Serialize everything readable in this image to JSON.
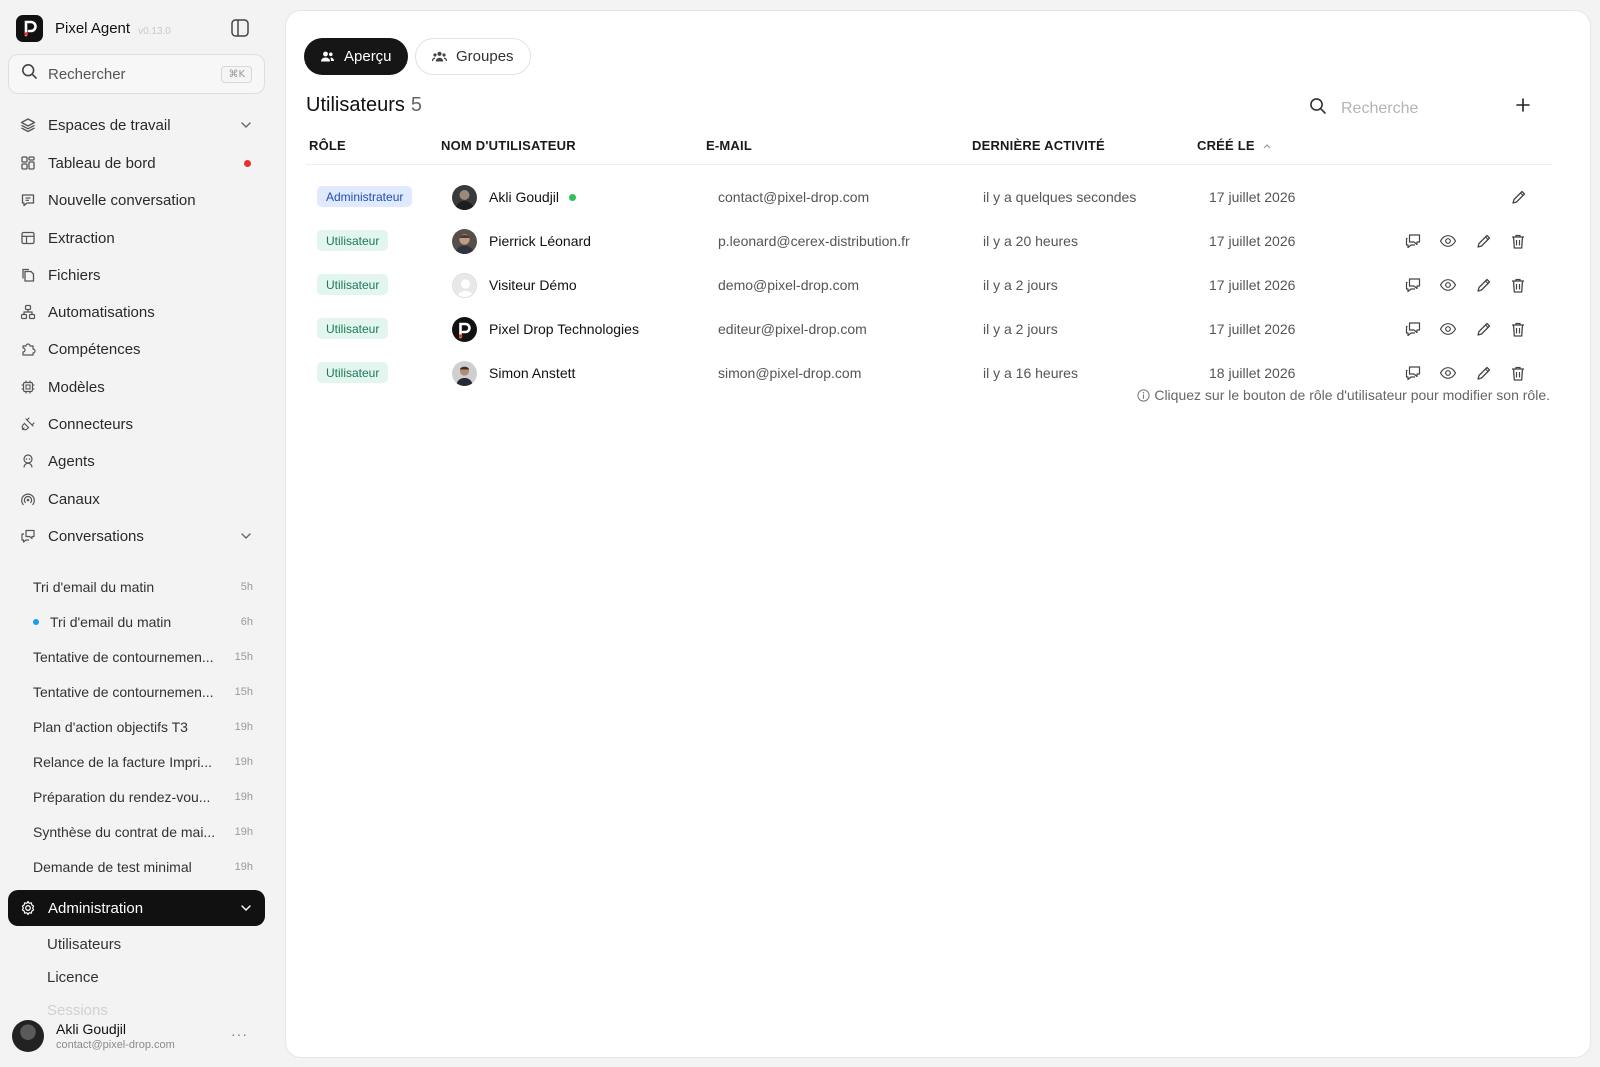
{
  "app": {
    "name": "Pixel Agent",
    "version": "v0.13.0"
  },
  "search": {
    "label": "Rechercher",
    "shortcut": "⌘K"
  },
  "nav": {
    "workspaces": "Espaces de travail",
    "dashboard": "Tableau de bord",
    "new_conversation": "Nouvelle conversation",
    "extraction": "Extraction",
    "files": "Fichiers",
    "automations": "Automatisations",
    "skills": "Compétences",
    "models": "Modèles",
    "connectors": "Connecteurs",
    "agents": "Agents",
    "channels": "Canaux",
    "conversations": "Conversations",
    "administration": "Administration"
  },
  "conversations": [
    {
      "title": "Tri d'email du matin",
      "time": "5h",
      "unread": false
    },
    {
      "title": "Tri d'email du matin",
      "time": "6h",
      "unread": true
    },
    {
      "title": "Tentative de contournemen...",
      "time": "15h",
      "unread": false
    },
    {
      "title": "Tentative de contournemen...",
      "time": "15h",
      "unread": false
    },
    {
      "title": "Plan d'action objectifs T3",
      "time": "19h",
      "unread": false
    },
    {
      "title": "Relance de la facture Impri...",
      "time": "19h",
      "unread": false
    },
    {
      "title": "Préparation du rendez-vou...",
      "time": "19h",
      "unread": false
    },
    {
      "title": "Synthèse du contrat de mai...",
      "time": "19h",
      "unread": false
    },
    {
      "title": "Demande de test minimal",
      "time": "19h",
      "unread": false
    }
  ],
  "admin_sub": {
    "users": "Utilisateurs",
    "license": "Licence",
    "sessions": "Sessions"
  },
  "current_user": {
    "name": "Akli Goudjil",
    "email": "contact@pixel-drop.com"
  },
  "tabs": {
    "overview": "Aperçu",
    "groups": "Groupes"
  },
  "page": {
    "title": "Utilisateurs",
    "count": "5",
    "search_placeholder": "Recherche"
  },
  "table": {
    "headers": {
      "role": "RÔLE",
      "username": "NOM D'UTILISATEUR",
      "email": "E-MAIL",
      "last_activity": "DERNIÈRE ACTIVITÉ",
      "created": "CRÉÉ LE"
    },
    "rows": [
      {
        "role": "Administrateur",
        "role_type": "admin",
        "name": "Akli Goudjil",
        "online": true,
        "email": "contact@pixel-drop.com",
        "last_activity": "il y a quelques secondes",
        "created": "17 juillet 2026"
      },
      {
        "role": "Utilisateur",
        "role_type": "user",
        "name": "Pierrick Léonard",
        "online": false,
        "email": "p.leonard@cerex-distribution.fr",
        "last_activity": "il y a 20 heures",
        "created": "17 juillet 2026"
      },
      {
        "role": "Utilisateur",
        "role_type": "user",
        "name": "Visiteur Démo",
        "online": false,
        "email": "demo@pixel-drop.com",
        "last_activity": "il y a 2 jours",
        "created": "17 juillet 2026"
      },
      {
        "role": "Utilisateur",
        "role_type": "user",
        "name": "Pixel Drop Technologies",
        "online": false,
        "email": "editeur@pixel-drop.com",
        "last_activity": "il y a 2 jours",
        "created": "17 juillet 2026"
      },
      {
        "role": "Utilisateur",
        "role_type": "user",
        "name": "Simon Anstett",
        "online": false,
        "email": "simon@pixel-drop.com",
        "last_activity": "il y a 16 heures",
        "created": "18 juillet 2026"
      }
    ],
    "note": "Cliquez sur le bouton de rôle d'utilisateur pour modifier son rôle."
  },
  "colors": {
    "accent_dark": "#161616",
    "admin_badge_bg": "#dfe9ff",
    "user_badge_bg": "#e2f5ee",
    "online": "#2fc05a",
    "notification": "#e5322d",
    "unread": "#1a9bf0"
  }
}
